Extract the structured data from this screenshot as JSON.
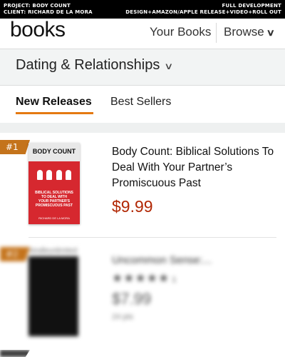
{
  "banner": {
    "project": "PROJECT: BODY COUNT",
    "client": "CLIENT:  RICHARD DE LA MORA",
    "scope_line1": "FULL DEVELOPMENT",
    "scope_line2": "DESIGN+AMAZON/APPLE RELEASE+VIDEO+ROLL OUT"
  },
  "header": {
    "logo": "books",
    "your_books": "Your Books",
    "browse": "Browse"
  },
  "category": {
    "label": "Dating & Relationships"
  },
  "tabs": [
    {
      "label": "New Releases",
      "active": true
    },
    {
      "label": "Best Sellers",
      "active": false
    }
  ],
  "items": [
    {
      "rank": "#1",
      "cover": {
        "title": "BODY COUNT",
        "subtitle_lines": [
          "BIBLICAL SOLUTIONS",
          "TO DEAL WITH",
          "YOUR PARTNER'S",
          "PROMISCUOUS PAST"
        ],
        "author": "RICHARD DE LA MORA"
      },
      "title": "Body Count: Biblical Solutions To Deal With Your Partner’s Promiscuous Past",
      "price": "$9.99"
    },
    {
      "rank": "#2",
      "badge": "kindleunlimited",
      "title": "Uncommon Sense:...",
      "rating_stars": 5,
      "rating_count": "1",
      "price": "$7.99",
      "pages": "24 pts"
    }
  ],
  "colors": {
    "accent": "#e47911",
    "rank_badge": "#c4731b",
    "price": "#b12704",
    "cover": "#d6282f"
  }
}
